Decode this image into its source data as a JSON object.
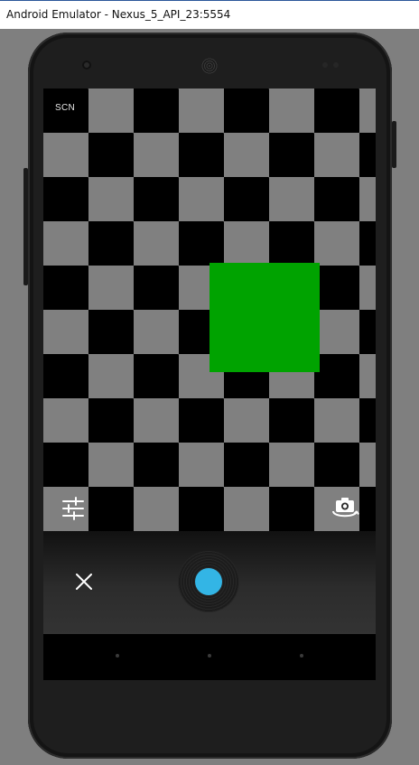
{
  "window": {
    "title": "Android Emulator - Nexus_5_API_23:5554"
  },
  "camera": {
    "scene_mode_label": "SCN",
    "icons": {
      "settings": "sliders-icon",
      "switch_camera": "switch-camera-icon",
      "cancel": "close-icon",
      "shutter": "shutter-button"
    }
  },
  "colors": {
    "shutter_accent": "#33b5e5",
    "checker_dark": "#000000",
    "checker_light": "#808080",
    "object": "#00a300"
  }
}
